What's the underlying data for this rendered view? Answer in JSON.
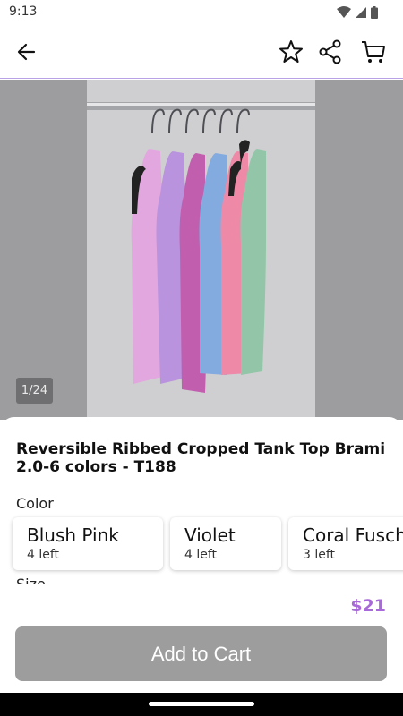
{
  "status_bar": {
    "time": "9:13",
    "icons": [
      "wifi-icon",
      "signal-icon",
      "battery-icon"
    ]
  },
  "app_bar": {
    "icons": [
      "back-arrow-icon",
      "star-icon",
      "share-icon",
      "cart-icon"
    ]
  },
  "gallery": {
    "counter": "1/24"
  },
  "product": {
    "title": "Reversible Ribbed Cropped Tank Top Brami 2.0-6 colors - T188",
    "color_label": "Color",
    "colors": [
      {
        "name": "Blush Pink",
        "stock": "4 left"
      },
      {
        "name": "Violet",
        "stock": "4 left"
      },
      {
        "name": "Coral Fuschia",
        "stock": "3 left"
      }
    ],
    "size_label": "Size",
    "price": "$21"
  },
  "footer": {
    "add_to_cart_label": "Add to Cart"
  },
  "colors": {
    "accent": "#a86ad8",
    "button": "#9d9d9d",
    "divider": "#b9a2e6"
  }
}
